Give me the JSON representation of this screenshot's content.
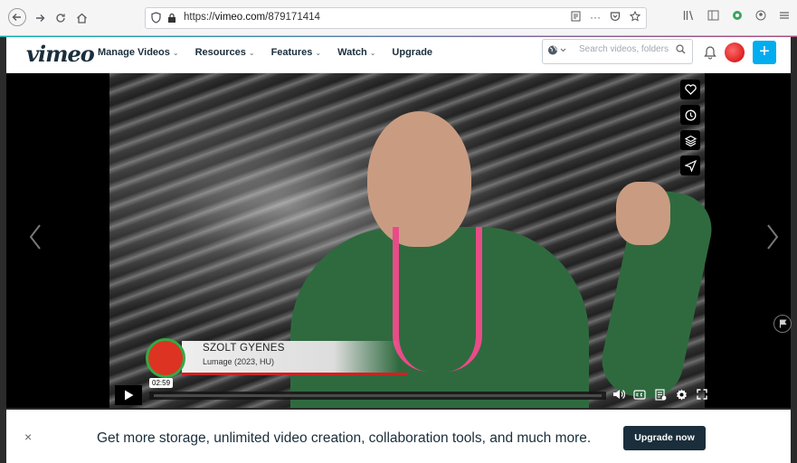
{
  "browser": {
    "url_prefix": "https://",
    "url_domain": "vimeo.com",
    "url_path": "/879171414",
    "more_glyph": "···"
  },
  "header": {
    "logo": "vimeo",
    "menu": [
      {
        "label": "Manage Videos",
        "chevron": "⌄"
      },
      {
        "label": "Resources",
        "chevron": "⌄"
      },
      {
        "label": "Features",
        "chevron": "⌄"
      },
      {
        "label": "Watch",
        "chevron": "⌄"
      },
      {
        "label": "Upgrade",
        "chevron": ""
      }
    ],
    "search_placeholder": "Search videos, folders, a",
    "plus_label": "+"
  },
  "video": {
    "lower_third_name": "SZOLT GYENES",
    "lower_third_sub": "Lumage (2023, HU)",
    "time_tooltip": "02:59",
    "side_actions": [
      "heart-icon",
      "clock-icon",
      "layers-icon",
      "send-icon"
    ],
    "control_icons": [
      "volume-icon",
      "cc-icon",
      "transcript-icon",
      "settings-icon",
      "fullscreen-icon"
    ]
  },
  "promo": {
    "close_glyph": "×",
    "text": "Get more storage, unlimited video creation, collaboration tools, and much more.",
    "button": "Upgrade now"
  },
  "colors": {
    "accent": "#00adef",
    "brand_dark": "#1a2e3b"
  }
}
